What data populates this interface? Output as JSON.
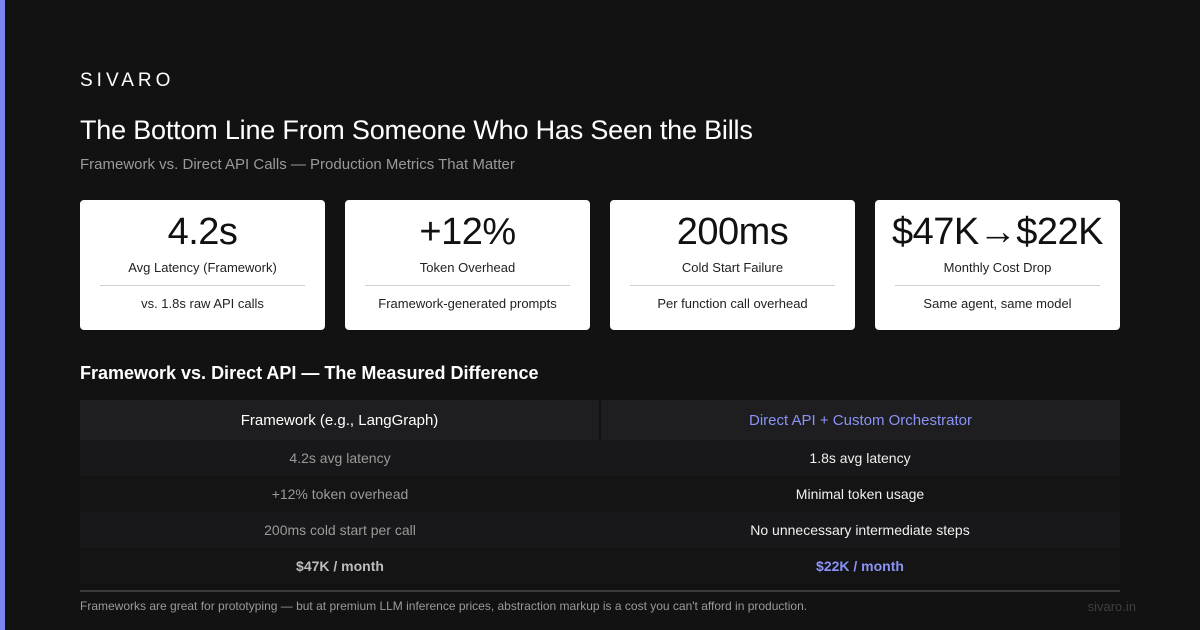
{
  "brand": "SIVARO",
  "title": "The Bottom Line From Someone Who Has Seen the Bills",
  "subtitle": "Framework vs. Direct API Calls — Production Metrics That Matter",
  "colors": {
    "accent": "#7b86f0",
    "background": "#121212",
    "card": "#ffffff",
    "highlight": "#8a93f5"
  },
  "cards": [
    {
      "value": "4.2s",
      "label": "Avg Latency (Framework)",
      "note": "vs. 1.8s raw API calls"
    },
    {
      "value": "+12%",
      "label": "Token Overhead",
      "note": "Framework-generated prompts"
    },
    {
      "value": "200ms",
      "label": "Cold Start Failure",
      "note": "Per function call overhead"
    },
    {
      "value": "$47K→$22K",
      "label": "Monthly Cost Drop",
      "note": "Same agent, same model"
    }
  ],
  "comparison": {
    "heading": "Framework vs. Direct API — The Measured Difference",
    "columns": [
      "Framework (e.g., LangGraph)",
      "Direct API + Custom Orchestrator"
    ],
    "rows": [
      [
        "4.2s avg latency",
        "1.8s avg latency"
      ],
      [
        "+12% token overhead",
        "Minimal token usage"
      ],
      [
        "200ms cold start per call",
        "No unnecessary intermediate steps"
      ],
      [
        "$47K / month",
        "$22K / month"
      ]
    ]
  },
  "footer": {
    "note": "Frameworks are great for prototyping — but at premium LLM inference prices, abstraction markup is a cost you can't afford in production.",
    "url": "sivaro.in"
  }
}
